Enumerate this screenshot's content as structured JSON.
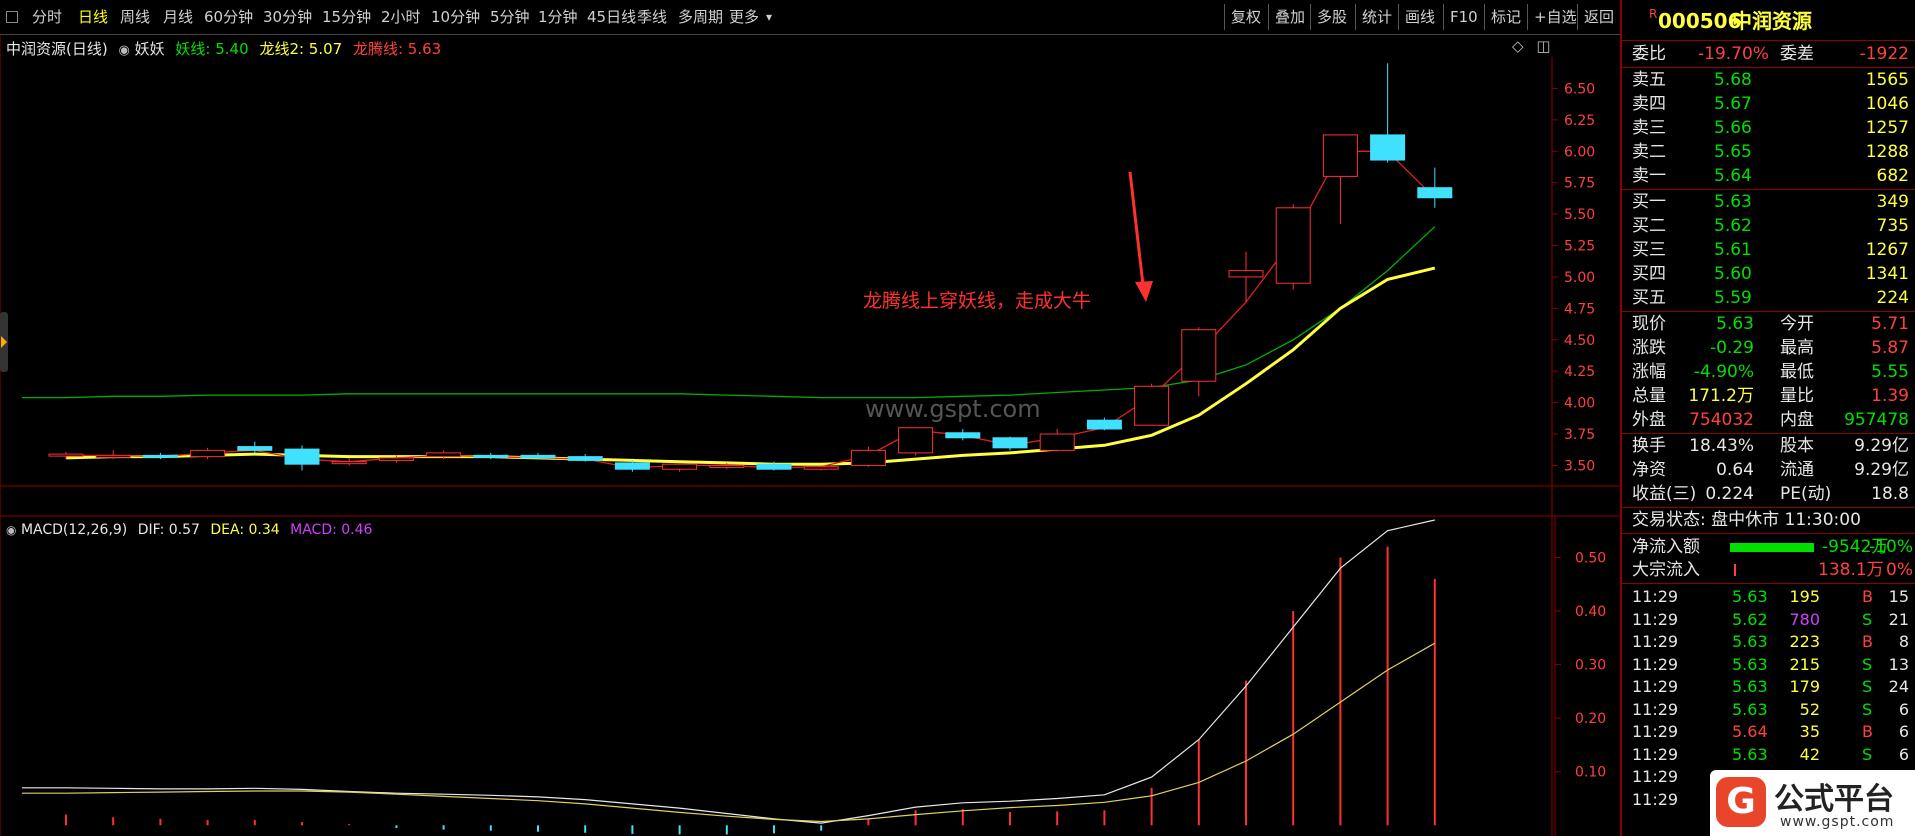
{
  "toolbar": {
    "periods": [
      "分时",
      "日线",
      "周线",
      "月线",
      "60分钟",
      "30分钟",
      "15分钟",
      "2小时",
      "10分钟",
      "5分钟",
      "1分钟",
      "45日线",
      "季线",
      "多周期",
      "更多"
    ],
    "active_period": "日线",
    "more_arrow": "▾",
    "right_buttons": [
      "复权",
      "叠加",
      "多股",
      "统计",
      "画线",
      "F10",
      "标记",
      "+自选",
      "返回"
    ]
  },
  "header": {
    "stock_name_period": "中润资源(日线)",
    "indicator_name": "妖妖",
    "yao_line_label": "妖线: 5.40",
    "long_line2_label": "龙线2: 5.07",
    "longteng_line_label": "龙腾线: 5.63",
    "corner_icons": [
      "◇",
      "◫"
    ]
  },
  "annotation": {
    "text": "龙腾线上穿妖线，走成大牛"
  },
  "watermark": "www.gspt.com",
  "macd_header": {
    "name": "MACD(12,26,9)",
    "dif": "DIF: 0.57",
    "dea": "DEA: 0.34",
    "macd": "MACD: 0.46"
  },
  "price_axis": [
    "6.50",
    "6.25",
    "6.00",
    "5.75",
    "5.50",
    "5.25",
    "5.00",
    "4.75",
    "4.50",
    "4.25",
    "4.00",
    "3.75",
    "3.50"
  ],
  "macd_axis": [
    "0.50",
    "0.40",
    "0.30",
    "0.20",
    "0.10"
  ],
  "chart_data": {
    "type": "candlestick",
    "price_ylim": [
      3.4,
      6.75
    ],
    "macd_ylim": [
      -0.02,
      0.57
    ],
    "candles": [
      {
        "o": 3.58,
        "h": 3.61,
        "l": 3.55,
        "c": 3.59
      },
      {
        "o": 3.57,
        "h": 3.62,
        "l": 3.55,
        "c": 3.58
      },
      {
        "o": 3.58,
        "h": 3.6,
        "l": 3.55,
        "c": 3.57
      },
      {
        "o": 3.57,
        "h": 3.64,
        "l": 3.55,
        "c": 3.62
      },
      {
        "o": 3.65,
        "h": 3.69,
        "l": 3.6,
        "c": 3.62
      },
      {
        "o": 3.63,
        "h": 3.66,
        "l": 3.46,
        "c": 3.51
      },
      {
        "o": 3.53,
        "h": 3.56,
        "l": 3.5,
        "c": 3.53
      },
      {
        "o": 3.54,
        "h": 3.58,
        "l": 3.52,
        "c": 3.56
      },
      {
        "o": 3.57,
        "h": 3.62,
        "l": 3.55,
        "c": 3.6
      },
      {
        "o": 3.58,
        "h": 3.6,
        "l": 3.55,
        "c": 3.57
      },
      {
        "o": 3.58,
        "h": 3.6,
        "l": 3.55,
        "c": 3.56
      },
      {
        "o": 3.57,
        "h": 3.59,
        "l": 3.53,
        "c": 3.54
      },
      {
        "o": 3.52,
        "h": 3.54,
        "l": 3.45,
        "c": 3.47
      },
      {
        "o": 3.47,
        "h": 3.52,
        "l": 3.45,
        "c": 3.51
      },
      {
        "o": 3.49,
        "h": 3.52,
        "l": 3.47,
        "c": 3.5
      },
      {
        "o": 3.51,
        "h": 3.53,
        "l": 3.46,
        "c": 3.47
      },
      {
        "o": 3.47,
        "h": 3.5,
        "l": 3.46,
        "c": 3.49
      },
      {
        "o": 3.5,
        "h": 3.65,
        "l": 3.49,
        "c": 3.62
      },
      {
        "o": 3.6,
        "h": 3.78,
        "l": 3.58,
        "c": 3.8
      },
      {
        "o": 3.76,
        "h": 3.79,
        "l": 3.7,
        "c": 3.72
      },
      {
        "o": 3.72,
        "h": 3.73,
        "l": 3.62,
        "c": 3.64
      },
      {
        "o": 3.62,
        "h": 3.79,
        "l": 3.61,
        "c": 3.75
      },
      {
        "o": 3.86,
        "h": 3.88,
        "l": 3.78,
        "c": 3.79
      },
      {
        "o": 3.82,
        "h": 4.15,
        "l": 3.82,
        "c": 4.13
      },
      {
        "o": 4.17,
        "h": 4.6,
        "l": 4.05,
        "c": 4.58
      },
      {
        "o": 5.0,
        "h": 5.2,
        "l": 4.8,
        "c": 5.05
      },
      {
        "o": 4.95,
        "h": 5.58,
        "l": 4.9,
        "c": 5.55
      },
      {
        "o": 5.8,
        "h": 6.13,
        "l": 5.42,
        "c": 6.13
      },
      {
        "o": 6.13,
        "h": 6.7,
        "l": 5.91,
        "c": 5.93
      },
      {
        "o": 5.71,
        "h": 5.87,
        "l": 5.55,
        "c": 5.63
      }
    ],
    "series": [
      {
        "name": "妖线",
        "color": "#00b000",
        "values": [
          4.04,
          4.05,
          4.05,
          4.06,
          4.06,
          4.06,
          4.07,
          4.07,
          4.07,
          4.07,
          4.07,
          4.07,
          4.07,
          4.07,
          4.06,
          4.05,
          4.04,
          4.04,
          4.04,
          4.05,
          4.06,
          4.08,
          4.1,
          4.12,
          4.18,
          4.3,
          4.5,
          4.75,
          5.05,
          5.4
        ]
      },
      {
        "name": "龙线2",
        "color": "#ffff40",
        "values": [
          3.56,
          3.57,
          3.57,
          3.58,
          3.59,
          3.58,
          3.57,
          3.57,
          3.57,
          3.57,
          3.56,
          3.55,
          3.54,
          3.53,
          3.52,
          3.51,
          3.51,
          3.52,
          3.55,
          3.58,
          3.6,
          3.63,
          3.66,
          3.74,
          3.9,
          4.15,
          4.42,
          4.75,
          4.98,
          5.07
        ]
      },
      {
        "name": "龙腾线",
        "color": "#e02020",
        "values": [
          3.58,
          3.58,
          3.57,
          3.6,
          3.62,
          3.55,
          3.53,
          3.56,
          3.58,
          3.57,
          3.56,
          3.55,
          3.48,
          3.5,
          3.5,
          3.48,
          3.49,
          3.58,
          3.78,
          3.74,
          3.66,
          3.72,
          3.8,
          4.05,
          4.4,
          4.8,
          5.3,
          6.0,
          6.0,
          5.63
        ]
      }
    ],
    "macd": {
      "dif": [
        0.07,
        0.069,
        0.068,
        0.068,
        0.069,
        0.067,
        0.063,
        0.06,
        0.058,
        0.056,
        0.053,
        0.048,
        0.04,
        0.032,
        0.022,
        0.012,
        0.004,
        0.018,
        0.034,
        0.042,
        0.045,
        0.05,
        0.057,
        0.09,
        0.16,
        0.26,
        0.37,
        0.48,
        0.55,
        0.57
      ],
      "dea": [
        0.06,
        0.061,
        0.062,
        0.063,
        0.064,
        0.064,
        0.062,
        0.058,
        0.054,
        0.05,
        0.046,
        0.04,
        0.032,
        0.024,
        0.017,
        0.011,
        0.007,
        0.012,
        0.02,
        0.027,
        0.033,
        0.037,
        0.043,
        0.055,
        0.08,
        0.12,
        0.17,
        0.23,
        0.29,
        0.34
      ],
      "bar": [
        0.02,
        0.015,
        0.012,
        0.01,
        0.01,
        0.006,
        0.002,
        -0.005,
        -0.008,
        -0.01,
        -0.012,
        -0.014,
        -0.016,
        -0.017,
        -0.017,
        -0.015,
        -0.01,
        0.012,
        0.028,
        0.03,
        0.025,
        0.026,
        0.028,
        0.07,
        0.16,
        0.27,
        0.4,
        0.5,
        0.52,
        0.46
      ]
    }
  },
  "quote": {
    "badge": "R",
    "code": "000506",
    "name": "中润资源",
    "weibi_label": "委比",
    "weibi": "-19.70%",
    "weicha_label": "委差",
    "weicha": "-1922",
    "sells": [
      {
        "label": "卖五",
        "price": "5.68",
        "vol": "1565"
      },
      {
        "label": "卖四",
        "price": "5.67",
        "vol": "1046"
      },
      {
        "label": "卖三",
        "price": "5.66",
        "vol": "1257"
      },
      {
        "label": "卖二",
        "price": "5.65",
        "vol": "1288"
      },
      {
        "label": "卖一",
        "price": "5.64",
        "vol": "682"
      }
    ],
    "buys": [
      {
        "label": "买一",
        "price": "5.63",
        "vol": "349"
      },
      {
        "label": "买二",
        "price": "5.62",
        "vol": "735"
      },
      {
        "label": "买三",
        "price": "5.61",
        "vol": "1267"
      },
      {
        "label": "买四",
        "price": "5.60",
        "vol": "1341"
      },
      {
        "label": "买五",
        "price": "5.59",
        "vol": "224"
      }
    ],
    "stats": [
      {
        "l1": "现价",
        "v1": "5.63",
        "c1": "green",
        "l2": "今开",
        "v2": "5.71",
        "c2": "red"
      },
      {
        "l1": "涨跌",
        "v1": "-0.29",
        "c1": "green",
        "l2": "最高",
        "v2": "5.87",
        "c2": "red"
      },
      {
        "l1": "涨幅",
        "v1": "-4.90%",
        "c1": "green",
        "l2": "最低",
        "v2": "5.55",
        "c2": "green"
      },
      {
        "l1": "总量",
        "v1": "171.2万",
        "c1": "yellow",
        "l2": "量比",
        "v2": "1.39",
        "c2": "red"
      },
      {
        "l1": "外盘",
        "v1": "754032",
        "c1": "red",
        "l2": "内盘",
        "v2": "957478",
        "c2": "green"
      }
    ],
    "stats2": [
      {
        "l1": "换手",
        "v1": "18.43%",
        "l2": "股本",
        "v2": "9.29亿"
      },
      {
        "l1": "净资",
        "v1": "0.64",
        "l2": "流通",
        "v2": "9.29亿"
      },
      {
        "l1": "收益(三)",
        "v1": "0.224",
        "l2": "PE(动)",
        "v2": "18.8"
      }
    ],
    "trade_status": "交易状态: 盘中休市 11:30:00",
    "net_inflow_label": "净流入额",
    "net_inflow_value": "-9542万",
    "net_inflow_pct": "-10%",
    "bulk_inflow_label": "大宗流入",
    "bulk_inflow_value": "138.1万",
    "bulk_inflow_pct": "0%",
    "ticks": [
      {
        "t": "11:29",
        "p": "5.63",
        "v": "195",
        "s": "B",
        "n": "15"
      },
      {
        "t": "11:29",
        "p": "5.62",
        "v": "780",
        "s": "S",
        "n": "21"
      },
      {
        "t": "11:29",
        "p": "5.63",
        "v": "223",
        "s": "B",
        "n": "8"
      },
      {
        "t": "11:29",
        "p": "5.63",
        "v": "215",
        "s": "S",
        "n": "13"
      },
      {
        "t": "11:29",
        "p": "5.63",
        "v": "179",
        "s": "S",
        "n": "24"
      },
      {
        "t": "11:29",
        "p": "5.63",
        "v": "52",
        "s": "S",
        "n": "6"
      },
      {
        "t": "11:29",
        "p": "5.64",
        "v": "35",
        "s": "B",
        "n": "6"
      },
      {
        "t": "11:29",
        "p": "5.63",
        "v": "42",
        "s": "S",
        "n": "6"
      },
      {
        "t": "11:29",
        "p": "",
        "v": "",
        "s": "",
        "n": ""
      },
      {
        "t": "11:29",
        "p": "",
        "v": "",
        "s": "",
        "n": ""
      }
    ]
  },
  "logo": {
    "text": "公式平台",
    "url_text": "www.gspt.com",
    "icon_letter": "G"
  }
}
